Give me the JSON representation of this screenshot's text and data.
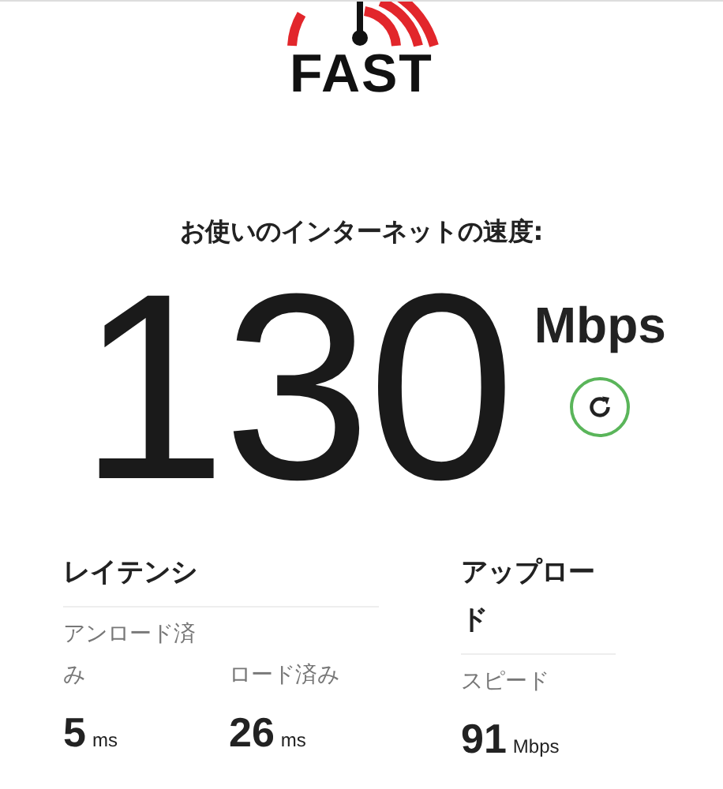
{
  "logo": {
    "text": "FAST"
  },
  "heading": "お使いのインターネットの速度:",
  "speed": {
    "value": "130",
    "unit": "Mbps"
  },
  "latency": {
    "title": "レイテンシ",
    "items": [
      {
        "label": "アンロード済み",
        "value": "5",
        "unit": "ms"
      },
      {
        "label": "ロード済み",
        "value": "26",
        "unit": "ms"
      }
    ]
  },
  "upload": {
    "title": "アップロード",
    "items": [
      {
        "label": "スピード",
        "value": "91",
        "unit": "Mbps"
      }
    ]
  }
}
